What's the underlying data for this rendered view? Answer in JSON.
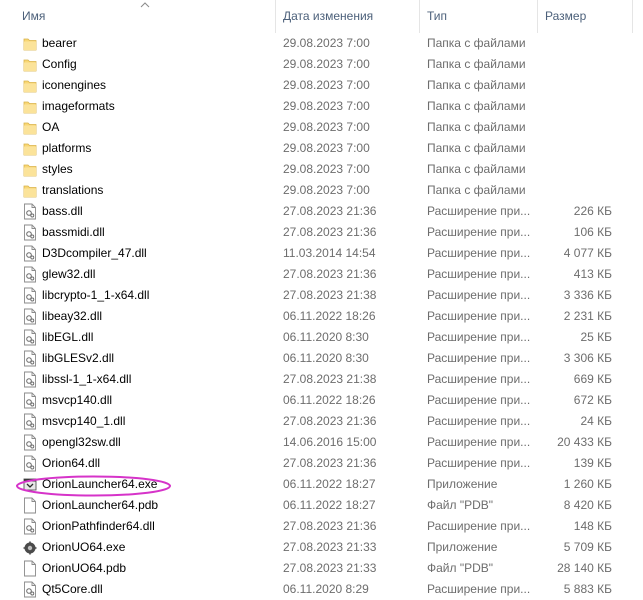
{
  "columns": {
    "name": "Имя",
    "date": "Дата изменения",
    "type": "Тип",
    "size": "Размер"
  },
  "accent_highlight_color": "#d633c9",
  "folder_color": "#f8d775",
  "files": [
    {
      "name": "bearer",
      "date": "29.08.2023 7:00",
      "type": "Папка с файлами",
      "size": "",
      "icon": "folder-icon"
    },
    {
      "name": "Config",
      "date": "29.08.2023 7:00",
      "type": "Папка с файлами",
      "size": "",
      "icon": "folder-icon"
    },
    {
      "name": "iconengines",
      "date": "29.08.2023 7:00",
      "type": "Папка с файлами",
      "size": "",
      "icon": "folder-icon"
    },
    {
      "name": "imageformats",
      "date": "29.08.2023 7:00",
      "type": "Папка с файлами",
      "size": "",
      "icon": "folder-icon"
    },
    {
      "name": "OA",
      "date": "29.08.2023 7:00",
      "type": "Папка с файлами",
      "size": "",
      "icon": "folder-icon"
    },
    {
      "name": "platforms",
      "date": "29.08.2023 7:00",
      "type": "Папка с файлами",
      "size": "",
      "icon": "folder-icon"
    },
    {
      "name": "styles",
      "date": "29.08.2023 7:00",
      "type": "Папка с файлами",
      "size": "",
      "icon": "folder-icon"
    },
    {
      "name": "translations",
      "date": "29.08.2023 7:00",
      "type": "Папка с файлами",
      "size": "",
      "icon": "folder-icon"
    },
    {
      "name": "bass.dll",
      "date": "27.08.2023 21:36",
      "type": "Расширение при...",
      "size": "226 КБ",
      "icon": "dll-icon"
    },
    {
      "name": "bassmidi.dll",
      "date": "27.08.2023 21:36",
      "type": "Расширение при...",
      "size": "106 КБ",
      "icon": "dll-icon"
    },
    {
      "name": "D3Dcompiler_47.dll",
      "date": "11.03.2014 14:54",
      "type": "Расширение при...",
      "size": "4 077 КБ",
      "icon": "dll-icon"
    },
    {
      "name": "glew32.dll",
      "date": "27.08.2023 21:36",
      "type": "Расширение при...",
      "size": "413 КБ",
      "icon": "dll-icon"
    },
    {
      "name": "libcrypto-1_1-x64.dll",
      "date": "27.08.2023 21:38",
      "type": "Расширение при...",
      "size": "3 336 КБ",
      "icon": "dll-icon"
    },
    {
      "name": "libeay32.dll",
      "date": "06.11.2022 18:26",
      "type": "Расширение при...",
      "size": "2 231 КБ",
      "icon": "dll-icon"
    },
    {
      "name": "libEGL.dll",
      "date": "06.11.2020 8:30",
      "type": "Расширение при...",
      "size": "25 КБ",
      "icon": "dll-icon"
    },
    {
      "name": "libGLESv2.dll",
      "date": "06.11.2020 8:30",
      "type": "Расширение при...",
      "size": "3 306 КБ",
      "icon": "dll-icon"
    },
    {
      "name": "libssl-1_1-x64.dll",
      "date": "27.08.2023 21:38",
      "type": "Расширение при...",
      "size": "669 КБ",
      "icon": "dll-icon"
    },
    {
      "name": "msvcp140.dll",
      "date": "06.11.2022 18:26",
      "type": "Расширение при...",
      "size": "672 КБ",
      "icon": "dll-icon"
    },
    {
      "name": "msvcp140_1.dll",
      "date": "27.08.2023 21:36",
      "type": "Расширение при...",
      "size": "24 КБ",
      "icon": "dll-icon"
    },
    {
      "name": "opengl32sw.dll",
      "date": "14.06.2016 15:00",
      "type": "Расширение при...",
      "size": "20 433 КБ",
      "icon": "dll-icon"
    },
    {
      "name": "Orion64.dll",
      "date": "27.08.2023 21:36",
      "type": "Расширение при...",
      "size": "139 КБ",
      "icon": "dll-icon"
    },
    {
      "name": "OrionLauncher64.exe",
      "date": "06.11.2022 18:27",
      "type": "Приложение",
      "size": "1 260 КБ",
      "icon": "launcher-exe-icon"
    },
    {
      "name": "OrionLauncher64.pdb",
      "date": "06.11.2022 18:27",
      "type": "Файл \"PDB\"",
      "size": "8 420 КБ",
      "icon": "file-icon"
    },
    {
      "name": "OrionPathfinder64.dll",
      "date": "27.08.2023 21:36",
      "type": "Расширение при...",
      "size": "148 КБ",
      "icon": "dll-icon"
    },
    {
      "name": "OrionUO64.exe",
      "date": "27.08.2023 21:33",
      "type": "Приложение",
      "size": "5 709 КБ",
      "icon": "gear-exe-icon"
    },
    {
      "name": "OrionUO64.pdb",
      "date": "27.08.2023 21:33",
      "type": "Файл \"PDB\"",
      "size": "28 140 КБ",
      "icon": "file-icon"
    },
    {
      "name": "Qt5Core.dll",
      "date": "06.11.2020 8:29",
      "type": "Расширение при...",
      "size": "5 883 КБ",
      "icon": "dll-icon"
    }
  ]
}
